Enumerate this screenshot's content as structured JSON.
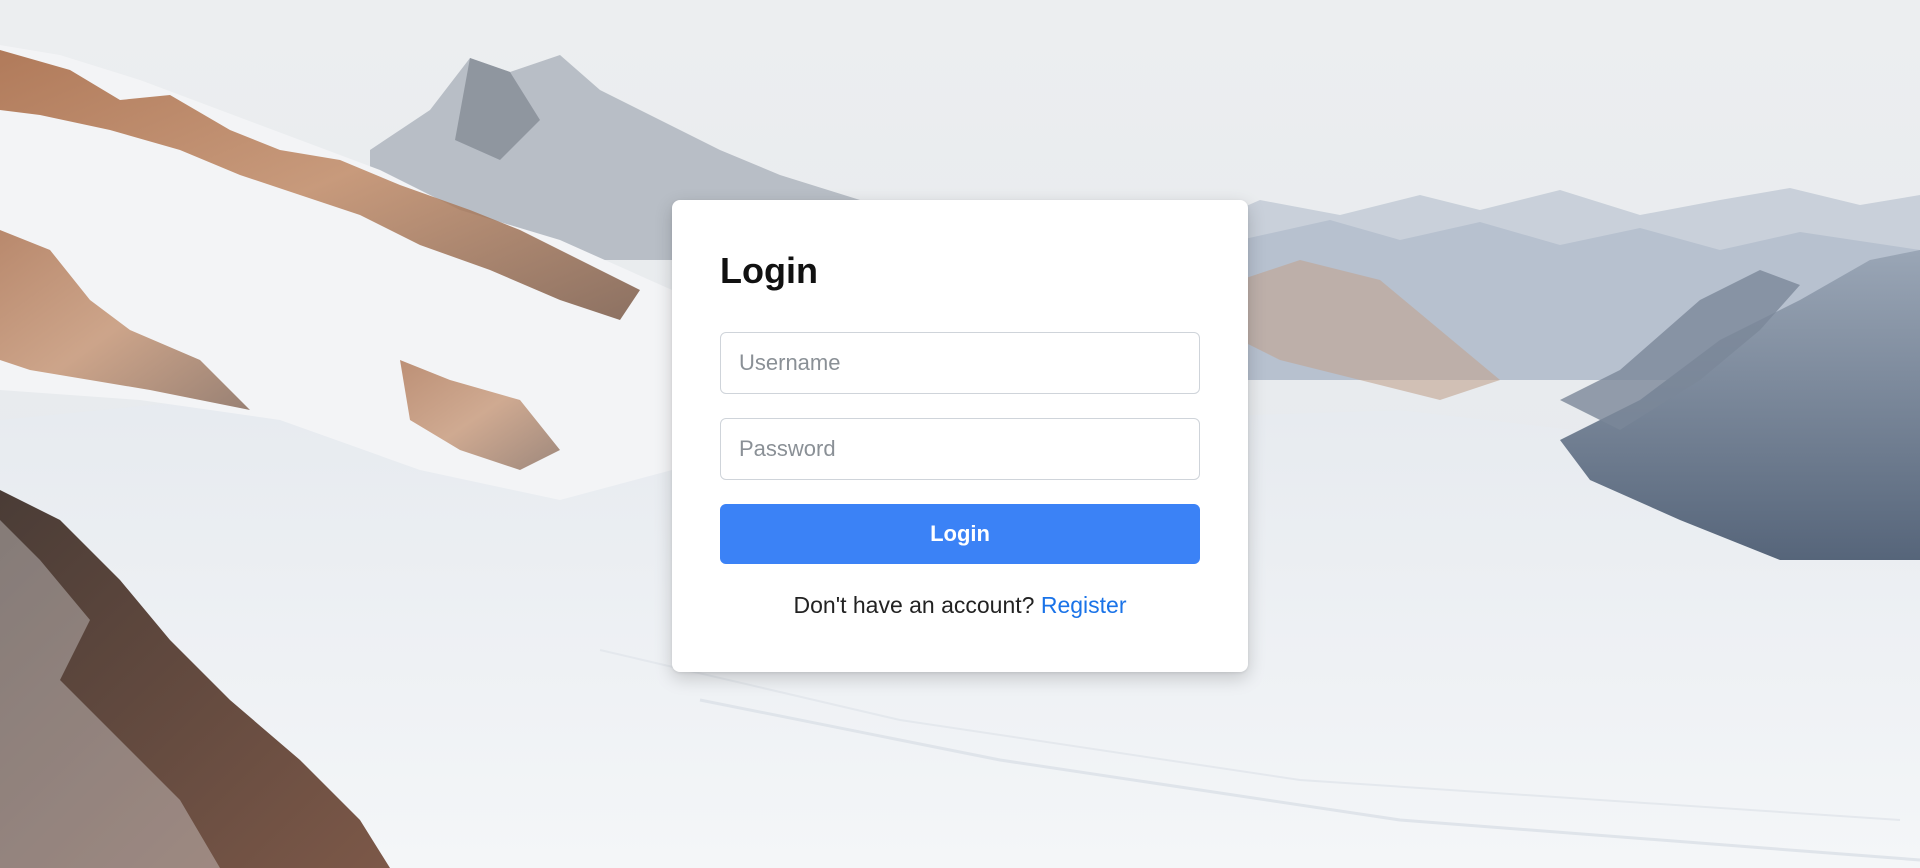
{
  "page": {
    "background": "snowy-mountain-landscape"
  },
  "login_card": {
    "title": "Login",
    "username_placeholder": "Username",
    "password_placeholder": "Password",
    "submit_label": "Login",
    "register_prompt": "Don't have an account?",
    "register_link": "Register"
  },
  "colors": {
    "primary": "#3b82f6",
    "link": "#1a73e8",
    "card_bg": "#ffffff",
    "input_border": "#cfd4da"
  }
}
